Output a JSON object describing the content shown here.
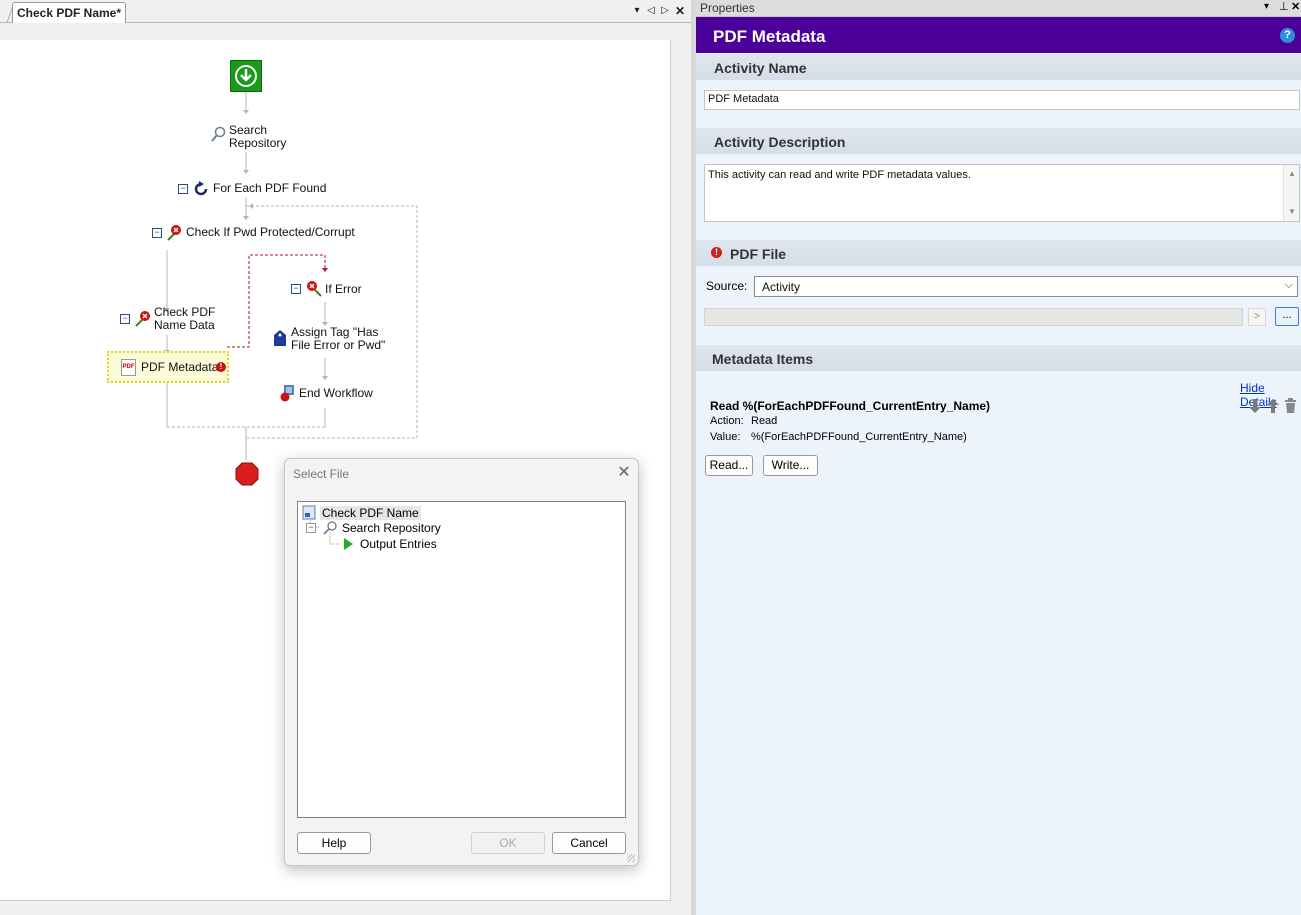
{
  "document_tab": {
    "title": "Check PDF Name*",
    "controls": [
      "▾",
      "◁",
      "▷",
      "✕"
    ]
  },
  "workflow": {
    "nodes": {
      "search_repository": "Search\nRepository",
      "for_each": "For Each PDF Found",
      "check_pwd": "Check If Pwd Protected/Corrupt",
      "if_error": "If Error",
      "check_pdf_name_data": "Check PDF\nName Data",
      "assign_tag": "Assign Tag \"Has\nFile Error or Pwd\"",
      "pdf_metadata": "PDF Metadata",
      "end_workflow": "End Workflow"
    }
  },
  "dialog": {
    "title": "Select File",
    "tree": {
      "root": "Check PDF Name",
      "child": "Search Repository",
      "grandchild": "Output Entries"
    },
    "buttons": {
      "help": "Help",
      "ok": "OK",
      "cancel": "Cancel"
    }
  },
  "properties": {
    "panel_title": "Properties",
    "activity_header": "PDF Metadata",
    "activity_name_label": "Activity Name",
    "activity_name_value": "PDF Metadata",
    "activity_description_label": "Activity Description",
    "activity_description_value": "This activity can read and write PDF metadata values.",
    "pdf_file_label": "PDF File",
    "source_label": "Source:",
    "source_value": "Activity",
    "arrow_button": ">",
    "browse_button": "...",
    "metadata_items_label": "Metadata Items",
    "hide_details_link": "Hide Details",
    "item": {
      "title": "Read %(ForEachPDFFound_CurrentEntry_Name)",
      "action_label": "Action:",
      "action_value": "Read",
      "value_label": "Value:",
      "value_value": "%(ForEachPDFFound_CurrentEntry_Name)"
    },
    "read_button": "Read...",
    "write_button": "Write..."
  },
  "colors": {
    "header_purple": "#4a0099",
    "start_green": "#1a9a1a",
    "stop_red": "#d81e1e",
    "error_red": "#cc1111",
    "link_blue": "#0033cc"
  }
}
